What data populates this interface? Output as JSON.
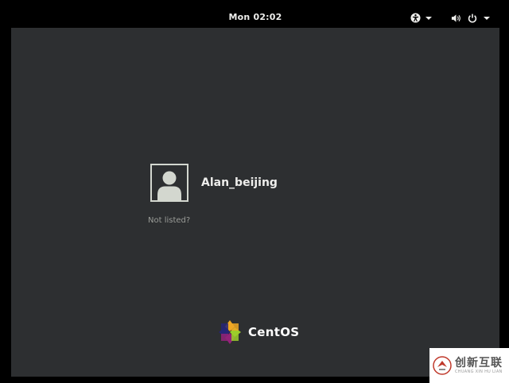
{
  "topbar": {
    "clock": "Mon 02:02",
    "icons": {
      "accessibility": "accessibility-icon",
      "volume": "volume-icon",
      "power": "power-icon",
      "dropdown": "chevron-down-icon"
    }
  },
  "login": {
    "user": {
      "name": "Alan_beijing",
      "avatar_icon": "avatar-icon"
    },
    "not_listed_label": "Not listed?"
  },
  "branding": {
    "name": "CentOS",
    "logo_icon": "centos-logo-icon"
  },
  "watermark": {
    "main": "创新互联",
    "sub": "CHUANG XIN HU LIAN"
  },
  "colors": {
    "background": "#2d2f31",
    "topbar": "#000000",
    "text": "#eeeeec",
    "muted_text": "#9a9c98"
  }
}
